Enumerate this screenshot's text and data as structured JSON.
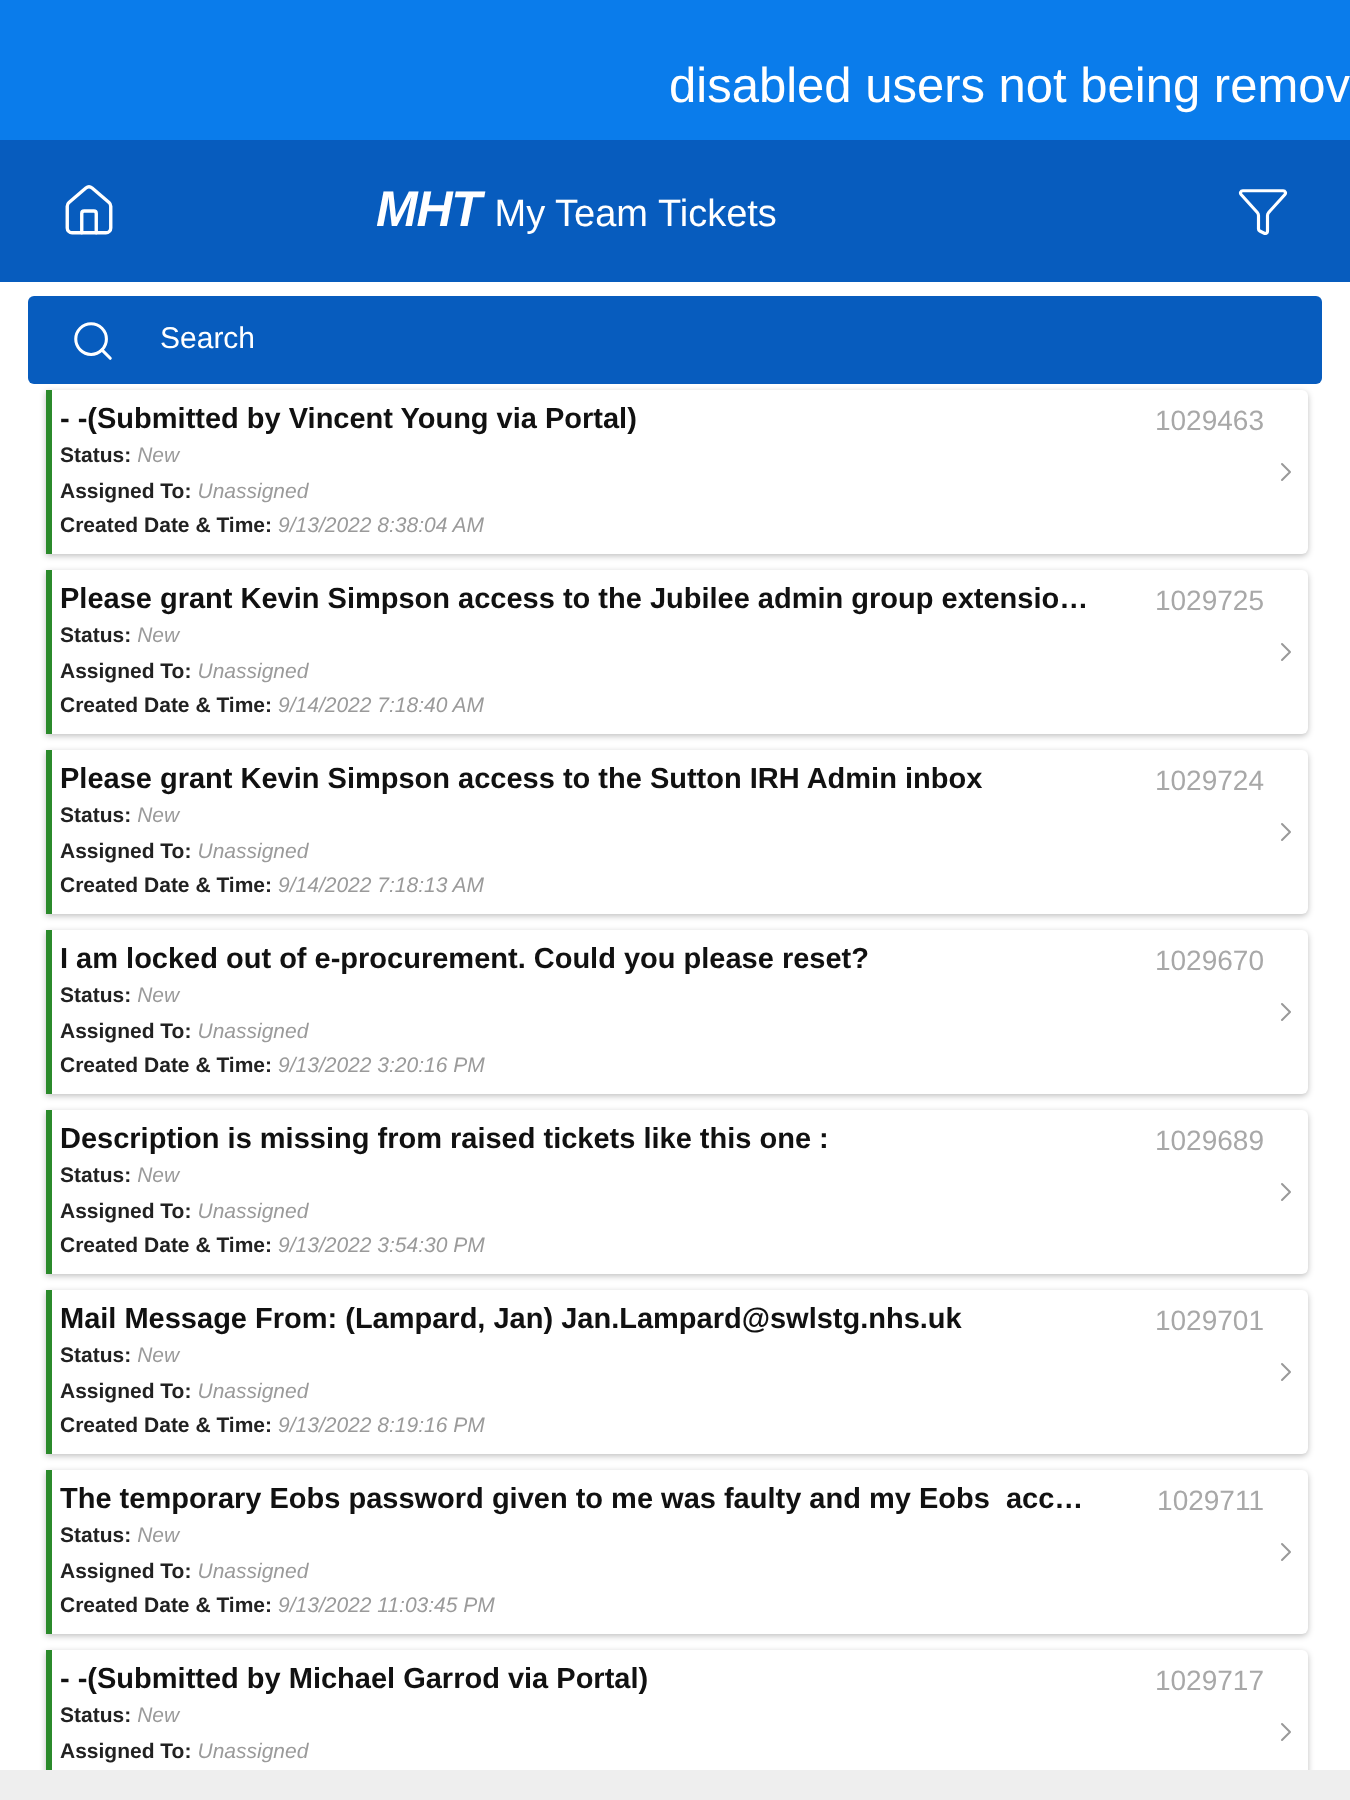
{
  "banner": {
    "text": "disabled users not being remov"
  },
  "header": {
    "logo": "MHT",
    "title": "My Team Tickets"
  },
  "search": {
    "placeholder": "Search"
  },
  "tickets": [
    {
      "title": "- -(Submitted by Vincent Young via Portal)",
      "number": "1029463",
      "fields": [
        {
          "label": "Status:",
          "value": "New"
        },
        {
          "label": "Assigned To:",
          "value": "Unassigned"
        },
        {
          "label": "Created Date & Time:",
          "value": "9/13/2022 8:38:04 AM"
        }
      ]
    },
    {
      "title": "Please grant Kevin Simpson access to the Jubilee admin group extensio…",
      "number": "1029725",
      "fields": [
        {
          "label": "Status:",
          "value": "New"
        },
        {
          "label": "Assigned To:",
          "value": "Unassigned"
        },
        {
          "label": "Created Date & Time:",
          "value": "9/14/2022 7:18:40 AM"
        }
      ]
    },
    {
      "title": "Please grant Kevin Simpson access to the Sutton IRH Admin inbox",
      "number": "1029724",
      "fields": [
        {
          "label": "Status:",
          "value": "New"
        },
        {
          "label": "Assigned To:",
          "value": "Unassigned"
        },
        {
          "label": "Created Date & Time:",
          "value": "9/14/2022 7:18:13 AM"
        }
      ]
    },
    {
      "title": "I am locked out of e-procurement. Could you please reset?",
      "number": "1029670",
      "fields": [
        {
          "label": "Status:",
          "value": "New"
        },
        {
          "label": "Assigned To:",
          "value": "Unassigned"
        },
        {
          "label": "Created Date & Time:",
          "value": "9/13/2022 3:20:16 PM"
        }
      ]
    },
    {
      "title": "Description is missing from raised tickets like this one :",
      "number": "1029689",
      "fields": [
        {
          "label": "Status:",
          "value": "New"
        },
        {
          "label": "Assigned To:",
          "value": "Unassigned"
        },
        {
          "label": "Created Date & Time:",
          "value": "9/13/2022 3:54:30 PM"
        }
      ]
    },
    {
      "title": "Mail Message From: (Lampard, Jan) Jan.Lampard@swlstg.nhs.uk",
      "number": "1029701",
      "fields": [
        {
          "label": "Status:",
          "value": "New"
        },
        {
          "label": "Assigned To:",
          "value": "Unassigned"
        },
        {
          "label": "Created Date & Time:",
          "value": "9/13/2022 8:19:16 PM"
        }
      ]
    },
    {
      "title": "The temporary Eobs password given to me was faulty and my Eobs  acc…",
      "number": "1029711",
      "fields": [
        {
          "label": "Status:",
          "value": "New"
        },
        {
          "label": "Assigned To:",
          "value": "Unassigned"
        },
        {
          "label": "Created Date & Time:",
          "value": "9/13/2022 11:03:45 PM"
        }
      ]
    },
    {
      "title": "- -(Submitted by Michael Garrod via Portal)",
      "number": "1029717",
      "fields": [
        {
          "label": "Status:",
          "value": "New"
        },
        {
          "label": "Assigned To:",
          "value": "Unassigned"
        }
      ]
    }
  ]
}
